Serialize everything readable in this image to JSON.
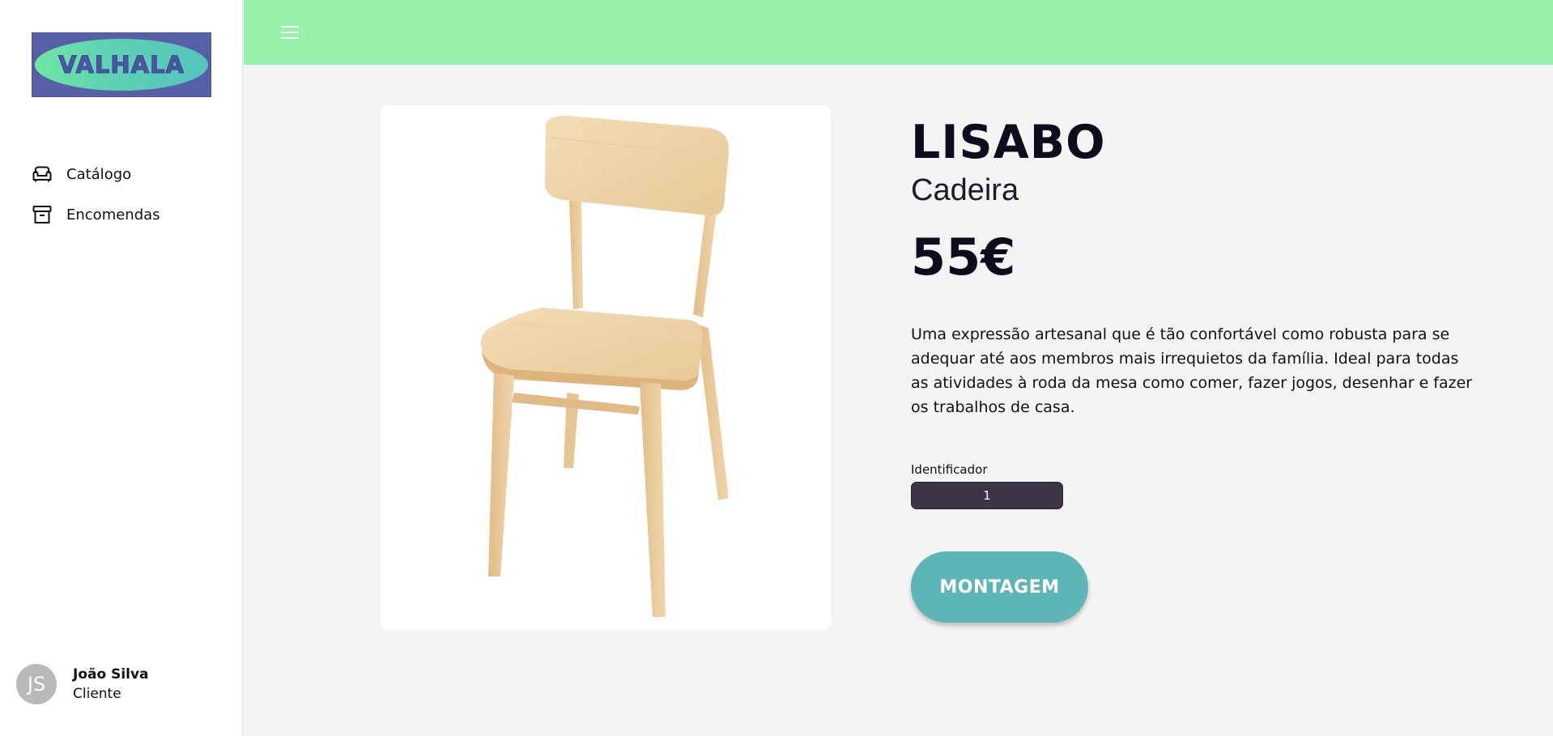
{
  "sidebar": {
    "logo_text": "VALHALA",
    "nav": [
      {
        "label": "Catálogo",
        "icon": "armchair-icon"
      },
      {
        "label": "Encomendas",
        "icon": "archive-box-icon"
      }
    ],
    "user": {
      "initials": "JS",
      "name": "João Silva",
      "role": "Cliente"
    }
  },
  "topbar": {
    "color": "#98f2ab",
    "menu_icon": "hamburger-menu-icon"
  },
  "product": {
    "name": "LISABO",
    "type": "Cadeira",
    "price": "55€",
    "description": "Uma expressão artesanal que é tão confortável como robusta para se adequar até aos membros mais irrequietos da família. Ideal para todas as atividades à roda da mesa como comer, fazer jogos, desenhar e fazer os trabalhos de casa.",
    "identifier_label": "Identificador",
    "identifier_value": "1",
    "action_button": "MONTAGEM"
  },
  "colors": {
    "accent_button": "#5eb5b6",
    "identifier_bg": "#3c3548",
    "logo_bg": "#5560a6"
  }
}
